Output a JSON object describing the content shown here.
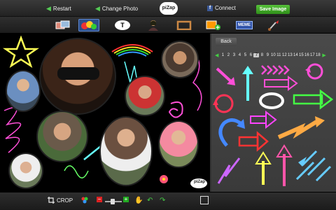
{
  "topbar": {
    "restart_label": "Restart",
    "change_photo_label": "Change Photo",
    "logo_text": "piZap",
    "connect_label": "Connect",
    "save_label": "Save Image"
  },
  "tools": [
    {
      "name": "tab-photo-effects",
      "icon": "photo-stack-icon"
    },
    {
      "name": "tab-stickers",
      "icon": "stickers-icon",
      "active": true
    },
    {
      "name": "tab-text",
      "icon": "text-bubble-icon",
      "label": "T"
    },
    {
      "name": "tab-cutout",
      "icon": "cutout-person-icon"
    },
    {
      "name": "tab-borders",
      "icon": "frame-icon"
    },
    {
      "name": "tab-add-photo",
      "icon": "add-photo-icon"
    },
    {
      "name": "tab-meme",
      "icon": "meme-icon",
      "label": "MEME"
    },
    {
      "name": "tab-paint",
      "icon": "paintbrush-icon"
    }
  ],
  "panel": {
    "back_label": "Back",
    "pages": [
      "1",
      "2",
      "3",
      "4",
      "5",
      "6",
      "7",
      "8",
      "9",
      "10",
      "11",
      "12",
      "13",
      "14",
      "15",
      "16",
      "17",
      "18"
    ],
    "current_page": "7"
  },
  "bottombar": {
    "crop_label": "CROP",
    "watermark": "piZap"
  },
  "colors": {
    "accent_green": "#3aaa22",
    "active_tab": "#2d4f8a",
    "neon_pink": "#ff4fd8",
    "neon_cyan": "#6ff",
    "neon_yellow": "#ff5"
  }
}
